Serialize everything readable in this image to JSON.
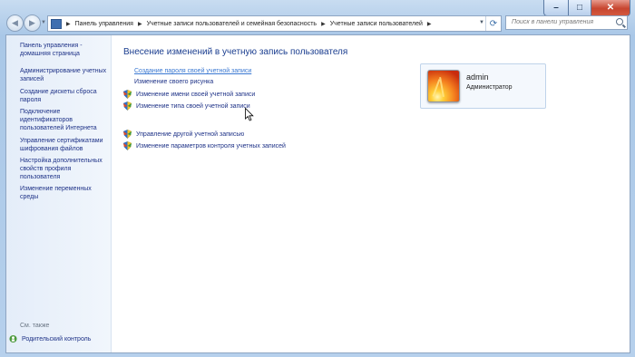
{
  "window": {
    "minimize": "–",
    "maximize": "□",
    "close": "✕"
  },
  "nav": {
    "breadcrumbs": [
      "Панель управления",
      "Учетные записи пользователей и семейная безопасность",
      "Учетные записи пользователей"
    ],
    "search_placeholder": "Поиск в панели управления"
  },
  "sidebar": {
    "items": [
      "Панель управления - домашняя страница",
      "Администрирование учетных записей",
      "Создание дискеты сброса пароля",
      "Подключение идентификаторов пользователей Интернета",
      "Управление сертификатами шифрования файлов",
      "Настройка дополнительных свойств профиля пользователя",
      "Изменение переменных среды"
    ],
    "see_also": "См. также",
    "parental_control": "Родительский контроль"
  },
  "main": {
    "title": "Внесение изменений в учетную запись пользователя",
    "tasks": [
      {
        "label": "Создание пароля своей учетной записи",
        "shield": false
      },
      {
        "label": "Изменение своего рисунка",
        "shield": false
      },
      {
        "label": "Изменение имени своей учетной записи",
        "shield": true
      },
      {
        "label": "Изменение типа своей учетной записи",
        "shield": true
      }
    ],
    "tasks2": [
      {
        "label": "Управление другой учетной записью",
        "shield": true
      },
      {
        "label": "Изменение параметров контроля учетных записей",
        "shield": true
      }
    ]
  },
  "user": {
    "name": "admin",
    "role": "Администратор"
  },
  "colors": {
    "link": "#1e3287",
    "title": "#1a3d8f",
    "link_hover": "#3a78d2"
  }
}
